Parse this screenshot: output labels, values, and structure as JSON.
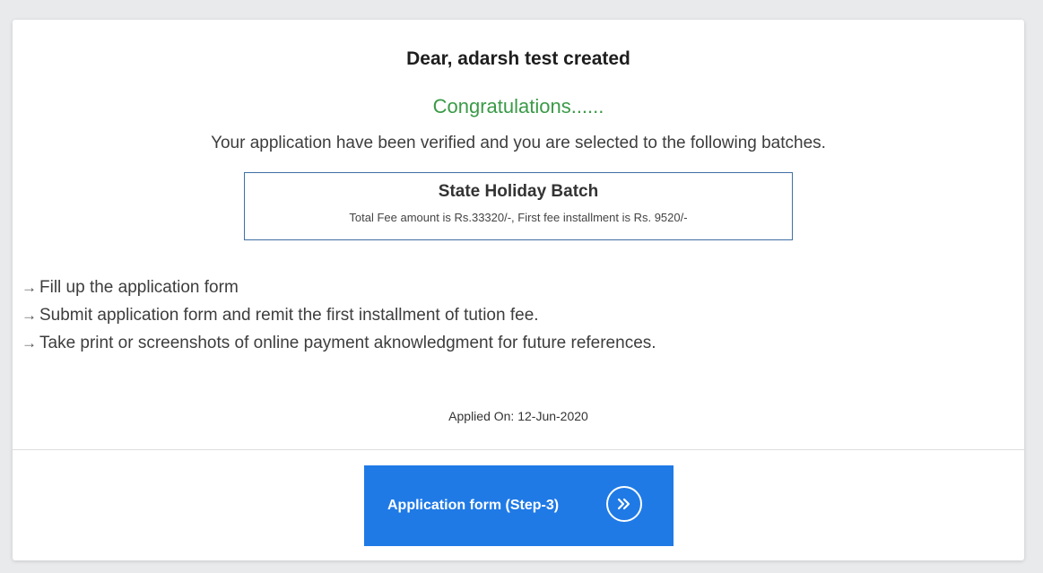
{
  "message": {
    "greeting": "Dear, adarsh test created",
    "congrats": "Congratulations......",
    "verified_text": "Your application have been verified and you are selected to the following batches."
  },
  "batch": {
    "name": "State Holiday Batch",
    "fee_text": "Total Fee amount is Rs.33320/-, First fee installment is Rs. 9520/-"
  },
  "steps": [
    "Fill up the application form",
    "Submit application form and remit the first installment of tution fee.",
    "Take print or screenshots of online payment aknowledgment for future references."
  ],
  "applied_on": "Applied On: 12-Jun-2020",
  "button": {
    "label": "Application form (Step-3)",
    "icon": "double-chevron-right-icon"
  },
  "colors": {
    "congrats": "#3a9a47",
    "button_bg": "#1f7ae6",
    "box_border": "#3f6fa3"
  }
}
